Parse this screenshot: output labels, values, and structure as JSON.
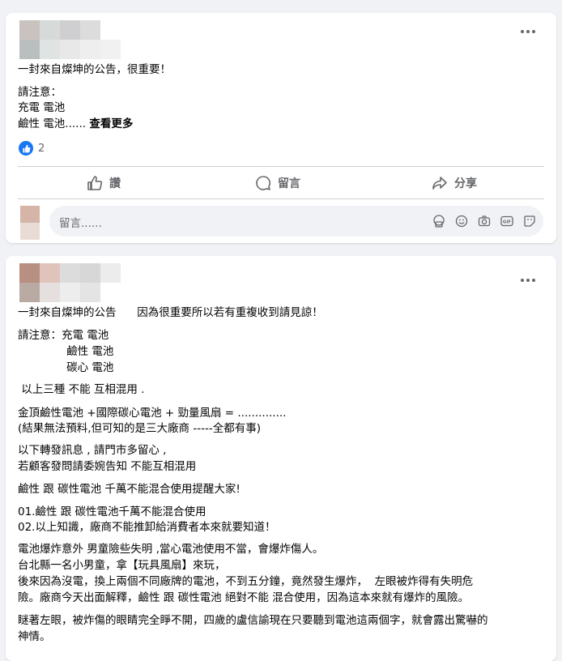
{
  "post1": {
    "title": "一封來自燦坤的公告，很重要！",
    "body_line1": "請注意：",
    "body_line2": "充電 電池",
    "body_line3_prefix": "鹼性 電池...... ",
    "see_more": "查看更多",
    "like_count": "2",
    "actions": {
      "like": "讚",
      "comment": "留言",
      "share": "分享"
    },
    "comment_placeholder": "留言......"
  },
  "post2": {
    "title": "一封來自燦坤的公告      因為很重要所以若有重複收到請見諒！",
    "lines": [
      "請注意：充電 電池",
      "              鹼性 電池",
      "              碳心 電池",
      " 以上三種 不能 互相混用 .",
      "金頂鹼性電池 +國際碳心電池 + 勁量風扇 = ..............",
      "(結果無法預料,但可知的是三大廠商 -----全都有事)",
      "以下轉發訊息 , 請門市多留心 ,",
      "若顧客發問請委婉告知 不能互相混用",
      "鹼性 跟 碳性電池 千萬不能混合使用提醒大家!",
      "01.鹼性 跟 碳性電池千萬不能混合使用",
      "02.以上知識，廠商不能推卸給消費者本來就要知道！",
      "電池爆炸意外 男童險些失明 ,當心電池使用不當，會爆炸傷人。",
      "台北縣一名小男童，拿【玩具風扇】來玩，",
      "後來因為沒電，換上兩個不同廠牌的電池，不到五分鐘，竟然發生爆炸，  左眼被炸得有失明危",
      "險。廠商今天出面解釋，鹼性 跟 碳性電池 絕對不能 混合使用，因為這本來就有爆炸的風險。",
      "瞇著左眼，被炸傷的眼睛完全睜不開，四歲的盧信諭現在只要聽到電池這兩個字，就會露出驚嚇的",
      "神情。"
    ]
  },
  "colors": {
    "brand_blue": "#1877f2",
    "secondary_text": "#65676b",
    "divider": "#ced0d4"
  }
}
